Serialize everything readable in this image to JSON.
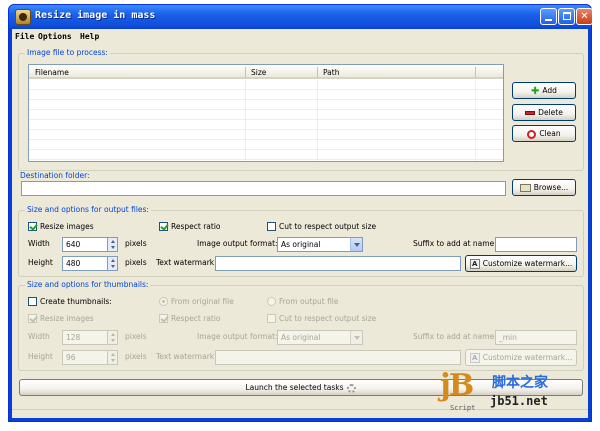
{
  "window": {
    "title": "Resize image in mass"
  },
  "menu": [
    "File",
    "Options",
    "Help"
  ],
  "files_group": {
    "legend": "Image file to process:",
    "columns": [
      "Filename",
      "Size",
      "Path"
    ],
    "buttons": {
      "add": "Add",
      "delete": "Delete",
      "clean": "Clean"
    }
  },
  "destination": {
    "legend": "Destination folder:",
    "value": "",
    "browse": "Browse..."
  },
  "output": {
    "legend": "Size and options for output files:",
    "resize_label": "Resize images",
    "resize_checked": true,
    "respect_ratio_label": "Respect ratio",
    "respect_ratio_checked": true,
    "cut_label": "Cut to respect output size",
    "cut_checked": false,
    "width_label": "Width",
    "width_value": "640",
    "height_label": "Height",
    "height_value": "480",
    "pixels": "pixels",
    "format_label": "Image output format:",
    "format_value": "As original",
    "suffix_label": "Suffix to add at name:",
    "suffix_value": "",
    "watermark_label": "Text watermark:",
    "watermark_value": "",
    "customize": "Customize watermark..."
  },
  "thumbs": {
    "legend": "Size and options for thumbnails:",
    "create_label": "Create thumbnails:",
    "create_checked": false,
    "from_original": "From original file",
    "from_output": "From output file",
    "resize_label": "Resize images",
    "respect_ratio_label": "Respect ratio",
    "cut_label": "Cut to respect output size",
    "width_label": "Width",
    "width_value": "128",
    "height_label": "Height",
    "height_value": "96",
    "pixels": "pixels",
    "format_label": "Image output format:",
    "format_value": "As original",
    "suffix_label": "Suffix to add at name:",
    "suffix_value": "_min",
    "watermark_label": "Text watermark:",
    "watermark_value": "",
    "customize": "Customize watermark..."
  },
  "launch": "Launch the selected tasks",
  "watermark_logo": {
    "jb": "jB",
    "script": "Script",
    "cn": "脚本之家",
    "url": "jb51.net"
  },
  "colors": {
    "accent": "#0046d5",
    "titlebar": "#0a3fd6",
    "face": "#ece9d8"
  }
}
